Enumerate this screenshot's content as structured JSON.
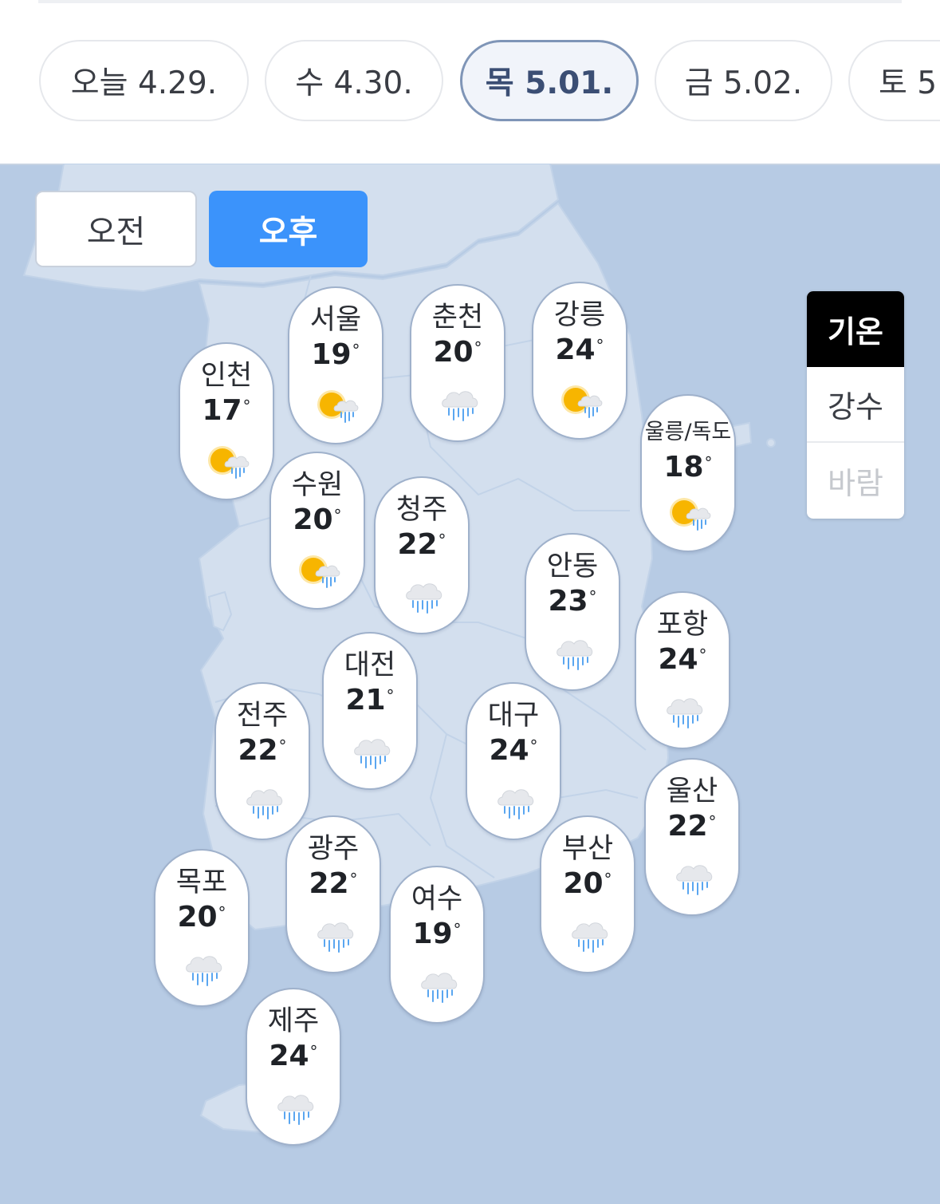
{
  "dates": [
    {
      "label": "오늘 4.29.",
      "active": false
    },
    {
      "label": "수 4.30.",
      "active": false
    },
    {
      "label": "목 5.01.",
      "active": true
    },
    {
      "label": "금 5.02.",
      "active": false
    },
    {
      "label": "토 5",
      "active": false
    }
  ],
  "time_toggle": {
    "am": "오전",
    "pm": "오후",
    "selected": "pm"
  },
  "legend": {
    "temp": "기온",
    "rain": "강수",
    "wind": "바람",
    "selected": "temp"
  },
  "degree_symbol": "°",
  "cities": [
    {
      "name": "서울",
      "temp": "19",
      "icon": "sun-rain-icon"
    },
    {
      "name": "춘천",
      "temp": "20",
      "icon": "rain-cloud-icon"
    },
    {
      "name": "강릉",
      "temp": "24",
      "icon": "sun-rain-icon"
    },
    {
      "name": "인천",
      "temp": "17",
      "icon": "sun-rain-icon"
    },
    {
      "name": "울릉/독도",
      "temp": "18",
      "icon": "sun-rain-icon"
    },
    {
      "name": "수원",
      "temp": "20",
      "icon": "sun-rain-icon"
    },
    {
      "name": "청주",
      "temp": "22",
      "icon": "rain-cloud-icon"
    },
    {
      "name": "안동",
      "temp": "23",
      "icon": "rain-cloud-icon"
    },
    {
      "name": "포항",
      "temp": "24",
      "icon": "rain-cloud-icon"
    },
    {
      "name": "대전",
      "temp": "21",
      "icon": "rain-cloud-icon"
    },
    {
      "name": "전주",
      "temp": "22",
      "icon": "rain-cloud-icon"
    },
    {
      "name": "대구",
      "temp": "24",
      "icon": "rain-cloud-icon"
    },
    {
      "name": "울산",
      "temp": "22",
      "icon": "rain-cloud-icon"
    },
    {
      "name": "광주",
      "temp": "22",
      "icon": "rain-cloud-icon"
    },
    {
      "name": "부산",
      "temp": "20",
      "icon": "rain-cloud-icon"
    },
    {
      "name": "목포",
      "temp": "20",
      "icon": "rain-cloud-icon"
    },
    {
      "name": "여수",
      "temp": "19",
      "icon": "rain-cloud-icon"
    },
    {
      "name": "제주",
      "temp": "24",
      "icon": "rain-cloud-icon"
    }
  ],
  "colors": {
    "map_sea": "#b7cbe4",
    "map_land": "#d3dfee",
    "accent": "#3b93fb",
    "rain": "#5aa6f0",
    "sun": "#f7b500"
  }
}
